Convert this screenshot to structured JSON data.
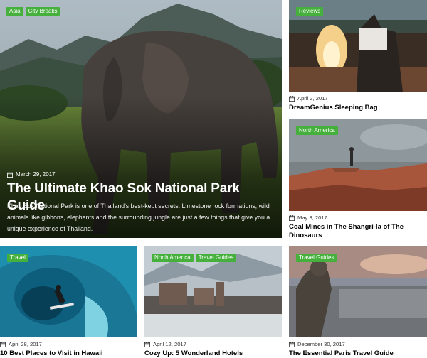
{
  "featured": {
    "tags": [
      "Asia",
      "City Breaks"
    ],
    "date": "March 29, 2017",
    "title": "The Ultimate Khao Sok National Park Guide",
    "excerpt": "Khao Sok National Park is one of Thailand's best-kept secrets. Limestone rock formations, wild animals like gibbons, elephants and the surrounding jungle are just a few things that give you a unique experience of Thailand."
  },
  "side_cards": [
    {
      "tag": "Reviews",
      "date": "April 2, 2017",
      "title": "DreamGenius Sleeping Bag"
    },
    {
      "tag": "North America",
      "date": "May 3, 2017",
      "title": "Coal Mines in The Shangri-la of The Dinosaurs"
    }
  ],
  "bottom_cards": [
    {
      "tags": [
        "Travel"
      ],
      "date": "April 28, 2017",
      "title": "10 Best Places to Visit in Hawaii"
    },
    {
      "tags": [
        "North America",
        "Travel Guides"
      ],
      "date": "April 12, 2017",
      "title": "Cozy Up: 5 Wonderland Hotels"
    },
    {
      "tags": [
        "Travel Guides"
      ],
      "date": "December 30, 2017",
      "title": "The Essential Paris Travel Guide"
    }
  ],
  "colors": {
    "tag_bg": "#45b03b",
    "title_text": "#000000"
  },
  "icons": {
    "date": "calendar-icon"
  }
}
